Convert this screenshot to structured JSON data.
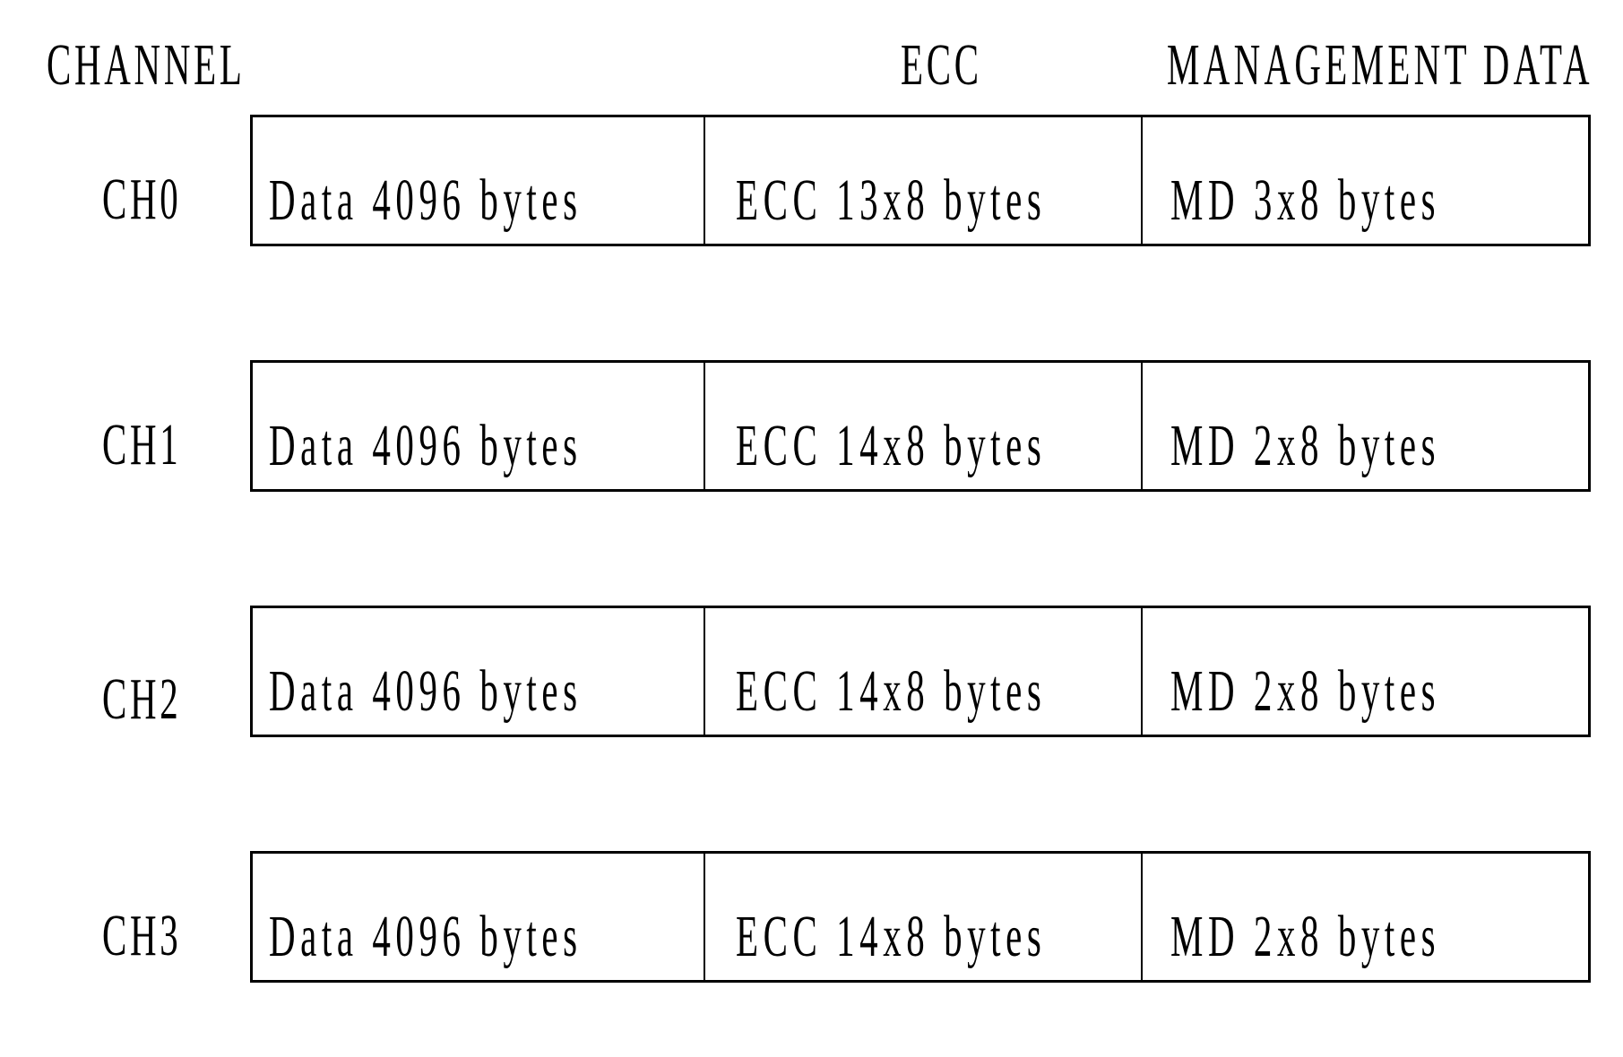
{
  "headers": {
    "channel": "CHANNEL",
    "ecc": "ECC",
    "management_data": "MANAGEMENT DATA"
  },
  "rows": [
    {
      "channel": "CH0",
      "data": "Data 4096 bytes",
      "ecc": "ECC 13x8 bytes",
      "md": "MD 3x8 bytes"
    },
    {
      "channel": "CH1",
      "data": "Data 4096 bytes",
      "ecc": "ECC 14x8 bytes",
      "md": "MD 2x8 bytes"
    },
    {
      "channel": "CH2",
      "data": "Data 4096 bytes",
      "ecc": "ECC 14x8 bytes",
      "md": "MD 2x8 bytes"
    },
    {
      "channel": "CH3",
      "data": "Data 4096 bytes",
      "ecc": "ECC 14x8 bytes",
      "md": "MD 2x8 bytes"
    }
  ]
}
